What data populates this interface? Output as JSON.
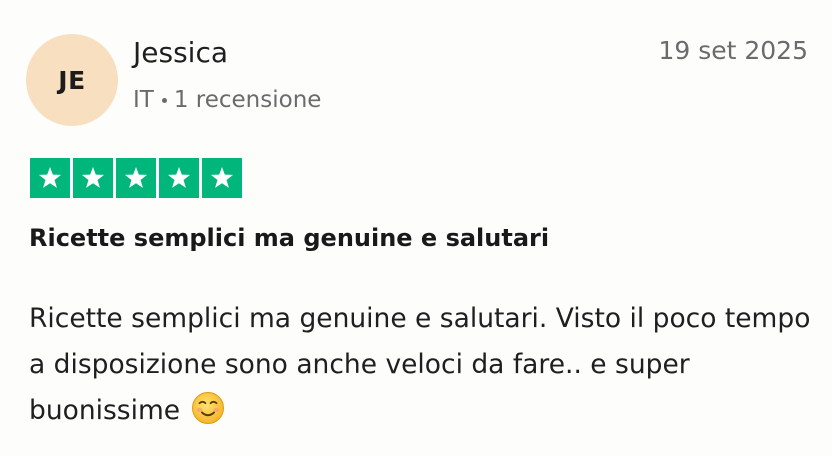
{
  "reviewer": {
    "initials": "JE",
    "name": "Jessica",
    "country": "IT",
    "review_count": "1 recensione"
  },
  "review": {
    "date": "19 set 2025",
    "rating": 5,
    "rating_max": 5,
    "title": "Ricette semplici ma genuine e salutari",
    "body": "Ricette semplici ma genuine e salutari. Visto il poco tempo a disposizione sono anche veloci da fare.. e super buonissime",
    "emoji": "smiling-face-icon"
  },
  "colors": {
    "star_fill": "#00b67a",
    "star_glyph": "#ffffff",
    "avatar_bg": "#f8dfbf",
    "meta_text": "#6b6b6b"
  }
}
